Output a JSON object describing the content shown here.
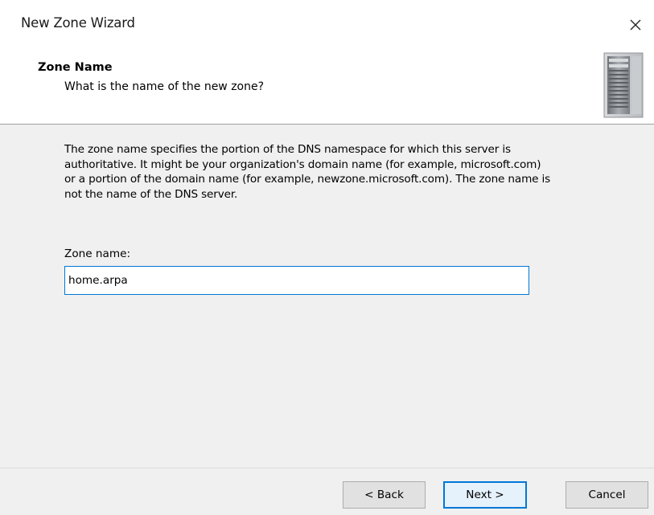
{
  "window": {
    "title": "New Zone Wizard",
    "close_icon": "close-icon"
  },
  "header": {
    "title": "Zone Name",
    "subtitle": "What is the name of the new zone?",
    "icon": "server-icon"
  },
  "body": {
    "description_lines": [
      "The zone name specifies the portion of the DNS namespace for which this server is",
      "authoritative. It might be your organization's domain name (for example,  microsoft.com)",
      "or a portion of the domain name (for example, newzone.microsoft.com). The zone name is",
      "not the name of the DNS server."
    ],
    "zone_name_label": "Zone name:",
    "zone_name_value": "home.arpa"
  },
  "buttons": {
    "back": "< Back",
    "next": "Next >",
    "cancel": "Cancel"
  },
  "colors": {
    "accent": "#0078d7",
    "body_bg": "#f0f0f0",
    "button_bg": "#e1e1e1"
  }
}
